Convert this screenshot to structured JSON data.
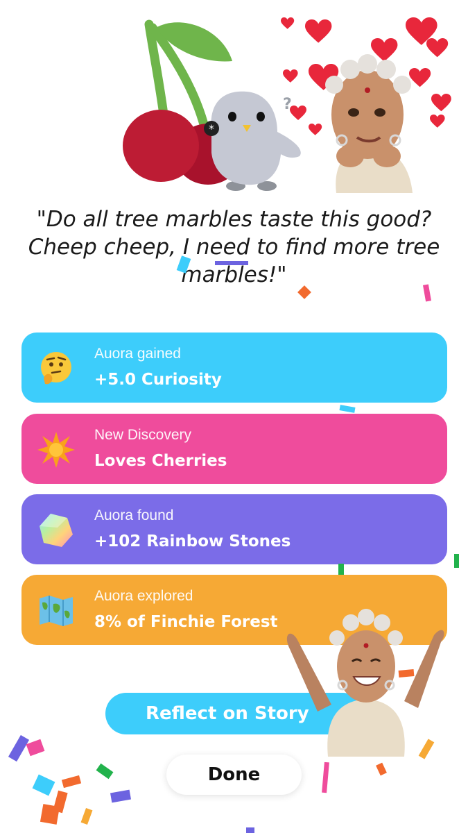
{
  "quote": "\"Do all tree marbles taste this good? Cheep cheep, I need to find more tree marbles!\"",
  "rewards": [
    {
      "icon": "thinking-face-icon",
      "label": "Auora gained",
      "value": "+5.0 Curiosity",
      "color": "#3dcdfb"
    },
    {
      "icon": "star-burst-icon",
      "label": "New Discovery",
      "value": "Loves Cherries",
      "color": "#ef4c9c"
    },
    {
      "icon": "rainbow-stone-icon",
      "label": "Auora found",
      "value": "+102 Rainbow Stones",
      "color": "#7b6ce8"
    },
    {
      "icon": "world-map-icon",
      "label": "Auora explored",
      "value": "8% of Finchie Forest",
      "color": "#f6a935"
    }
  ],
  "buttons": {
    "reflect": "Reflect on Story",
    "done": "Done"
  },
  "hero": {
    "question_mark": "?"
  }
}
